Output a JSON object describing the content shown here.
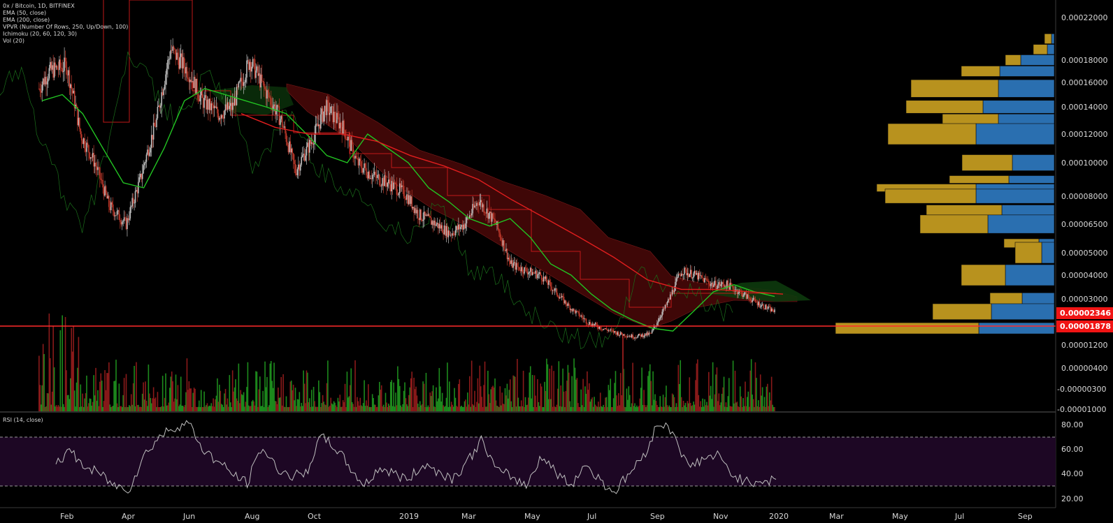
{
  "legend": {
    "title": "0x / Bitcoin, 1D, BITFINEX",
    "lines": [
      "EMA (50, close)",
      "EMA (200, close)",
      "VPVR (Number Of Rows, 250, Up/Down, 100)",
      "Ichimoku (20, 60, 120, 30)",
      "Vol (20)"
    ]
  },
  "rsi": {
    "title": "RSI (14, close)",
    "ticks": [
      "80.00",
      "60.00",
      "40.00",
      "20.00"
    ]
  },
  "price_ticks": [
    "0.00022000",
    "0.00018000",
    "0.00016000",
    "0.00014000",
    "0.00012000",
    "0.00010000",
    "0.00008000",
    "0.00006500",
    "0.00005000",
    "0.00004000",
    "0.00003000",
    "0.00001200",
    "0.00000400",
    "-0.00000300",
    "-0.00001000"
  ],
  "price_tags": {
    "last": "0.00002346",
    "line": "0.00001878"
  },
  "date_ticks": [
    "Feb",
    "Apr",
    "Jun",
    "Aug",
    "Oct",
    "2019",
    "Mar",
    "May",
    "Jul",
    "Sep",
    "Nov",
    "2020",
    "Mar",
    "May",
    "Jul",
    "Sep"
  ],
  "colors": {
    "background": "#000000",
    "ema50": "#22c422",
    "ema200": "#e01e1e",
    "price_line": "#ff2a2a",
    "tag_red": "#f01414",
    "vp_up": "#2a6fb0",
    "vp_down": "#b8921e",
    "rsi_line": "#bfbfbf",
    "rsi_band": "#1d0724",
    "candle_up": "#bfbfbf",
    "candle_down": "#c0392b",
    "vol_up": "#1d8a1d",
    "vol_down": "#8a1a1a"
  },
  "chart_data": {
    "type": "line",
    "price": {
      "x": [
        "2018-01-05",
        "2018-01-15",
        "2018-02-01",
        "2018-02-15",
        "2018-03-01",
        "2018-03-15",
        "2018-04-01",
        "2018-04-15",
        "2018-05-01",
        "2018-05-15",
        "2018-06-01",
        "2018-06-15",
        "2018-07-01",
        "2018-07-15",
        "2018-08-01",
        "2018-08-15",
        "2018-09-01",
        "2018-09-15",
        "2018-10-01",
        "2018-10-15",
        "2018-11-01",
        "2018-11-15",
        "2018-12-01",
        "2018-12-15",
        "2019-01-01",
        "2019-01-15",
        "2019-02-01",
        "2019-02-15",
        "2019-03-01",
        "2019-03-15",
        "2019-04-01",
        "2019-04-15",
        "2019-05-01",
        "2019-05-15",
        "2019-06-01",
        "2019-06-15",
        "2019-07-01",
        "2019-07-15",
        "2019-08-01",
        "2019-08-15",
        "2019-09-01",
        "2019-09-15",
        "2019-10-01",
        "2019-10-15",
        "2019-11-01",
        "2019-11-15",
        "2019-12-01",
        "2019-12-15",
        "2020-01-01"
      ],
      "close": [
        0.000155,
        0.00017,
        0.000175,
        0.00012,
        0.0001,
        7.5e-05,
        6.5e-05,
        9e-05,
        0.00013,
        0.00019,
        0.00017,
        0.000145,
        0.000135,
        0.00014,
        0.00018,
        0.000155,
        0.00013,
        9.5e-05,
        0.000115,
        0.00014,
        0.000125,
        0.0001,
        9.2e-05,
        8.8e-05,
        8.2e-05,
        7e-05,
        6.5e-05,
        6e-05,
        6.5e-05,
        7.8e-05,
        6.5e-05,
        4.5e-05,
        4.2e-05,
        4e-05,
        3.2e-05,
        2.5e-05,
        2e-05,
        1.8e-05,
        1.6e-05,
        1.5e-05,
        1.6e-05,
        2.6e-05,
        4.2e-05,
        4e-05,
        3.6e-05,
        3.6e-05,
        3.2e-05,
        2.8e-05,
        2.4e-05
      ]
    },
    "ema50": [
      0.000145,
      0.00015,
      0.000135,
      0.00011,
      8.8e-05,
      8.5e-05,
      0.00011,
      0.000145,
      0.000155,
      0.00015,
      0.000145,
      0.00014,
      0.000135,
      0.00012,
      0.000105,
      0.0001,
      0.00012,
      0.00011,
      0.0001,
      8.5e-05,
      7.7e-05,
      6.8e-05,
      6.4e-05,
      6.8e-05,
      5.8e-05,
      4.5e-05,
      4e-05,
      3.2e-05,
      2.5e-05,
      2.1e-05,
      1.8e-05,
      1.7e-05,
      2.4e-05,
      3.3e-05,
      3.6e-05,
      3.3e-05,
      3.1e-05
    ],
    "ema200": [
      0.000135,
      0.000125,
      0.00012,
      0.00012,
      0.000115,
      0.000105,
      9.8e-05,
      9e-05,
      7.8e-05,
      6.8e-05,
      5.8e-05,
      4.8e-05,
      3.8e-05,
      3.4e-05,
      3.4e-05,
      3.3e-05,
      3.2e-05
    ],
    "volume_profile": [
      {
        "price": 0.0002,
        "up": 4,
        "down": 10
      },
      {
        "price": 0.00019,
        "up": 10,
        "down": 20
      },
      {
        "price": 0.00018,
        "up": 48,
        "down": 22
      },
      {
        "price": 0.00017,
        "up": 78,
        "down": 55
      },
      {
        "price": 0.00016,
        "up": 80,
        "down": 75
      },
      {
        "price": 0.000155,
        "up": 80,
        "down": 125
      },
      {
        "price": 0.00014,
        "up": 102,
        "down": 110
      },
      {
        "price": 0.00013,
        "up": 80,
        "down": 80
      },
      {
        "price": 0.00012,
        "up": 112,
        "down": 126
      },
      {
        "price": 0.0001,
        "up": 60,
        "down": 72
      },
      {
        "price": 9e-05,
        "up": 65,
        "down": 85
      },
      {
        "price": 8.5e-05,
        "up": 112,
        "down": 142
      },
      {
        "price": 8e-05,
        "up": 112,
        "down": 130
      },
      {
        "price": 7.2e-05,
        "up": 75,
        "down": 108
      },
      {
        "price": 6.5e-05,
        "up": 95,
        "down": 97
      },
      {
        "price": 5.5e-05,
        "up": 22,
        "down": 50
      },
      {
        "price": 5e-05,
        "up": 18,
        "down": 38
      },
      {
        "price": 4e-05,
        "up": 70,
        "down": 63
      },
      {
        "price": 3e-05,
        "up": 46,
        "down": 46
      },
      {
        "price": 2.4e-05,
        "up": 90,
        "down": 84
      },
      {
        "price": 1.8e-05,
        "up": 108,
        "down": 205
      }
    ],
    "rsi": [
      50,
      58,
      45,
      40,
      30,
      28,
      55,
      70,
      78,
      82,
      60,
      50,
      40,
      32,
      62,
      45,
      38,
      40,
      70,
      62,
      45,
      30,
      45,
      40,
      35,
      48,
      42,
      36,
      50,
      68,
      42,
      38,
      30,
      55,
      42,
      30,
      48,
      35,
      25,
      40,
      55,
      82,
      75,
      45,
      52,
      55,
      40,
      33,
      35,
      34
    ]
  }
}
